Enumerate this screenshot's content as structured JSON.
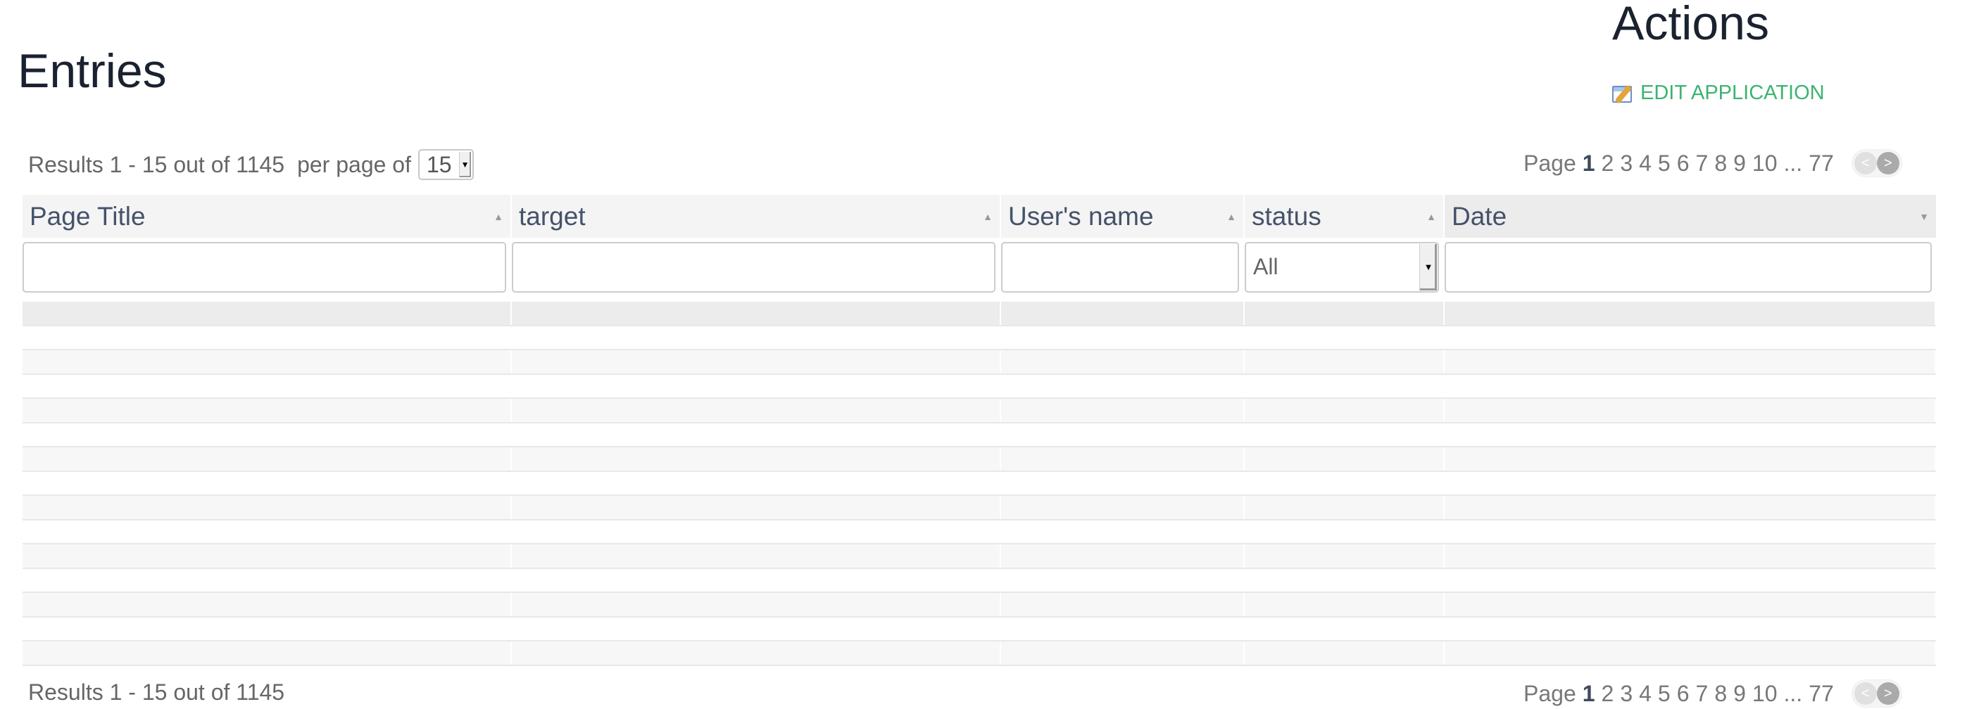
{
  "entries_title": "Entries",
  "actions": {
    "title": "Actions",
    "edit_label": "EDIT APPLICATION",
    "edit_icon": "edit-application-icon",
    "link_color": "#3cb371"
  },
  "results": {
    "text": "Results 1 - 15 out of 1145",
    "per_page_label": "per page of",
    "per_page_value": "15"
  },
  "pager": {
    "label": "Page",
    "current": "1",
    "pages": [
      "2",
      "3",
      "4",
      "5",
      "6",
      "7",
      "8",
      "9",
      "10"
    ],
    "ellipsis": "...",
    "last": "77"
  },
  "columns": [
    {
      "label": "Page Title",
      "sort": "asc"
    },
    {
      "label": "target",
      "sort": "asc"
    },
    {
      "label": "User's name",
      "sort": "asc"
    },
    {
      "label": "status",
      "sort": "asc"
    },
    {
      "label": "Date",
      "sort": "desc"
    }
  ],
  "filters": {
    "status_value": "All"
  },
  "row_count": 15
}
